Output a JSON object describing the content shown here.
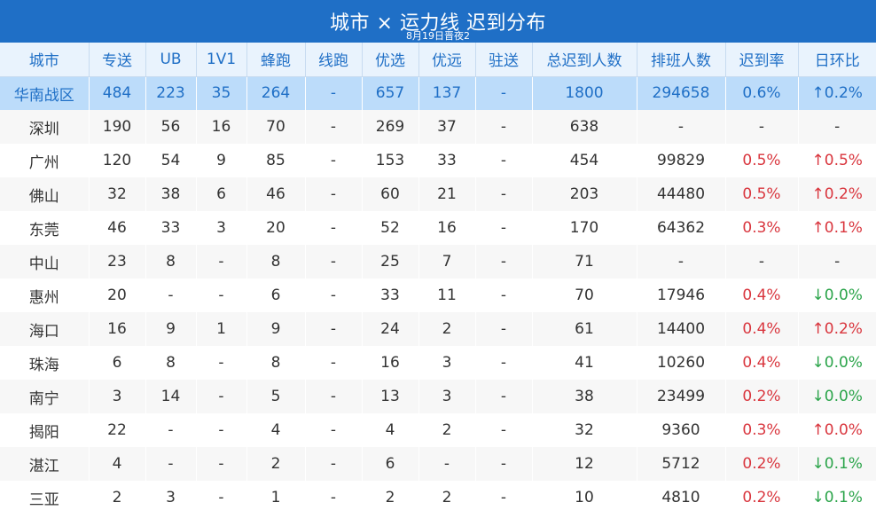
{
  "header": {
    "title": "城市 × 运力线 迟到分布",
    "subtitle": "8月19日晋夜2"
  },
  "columns": [
    "城市",
    "专送",
    "UB",
    "1V1",
    "蜂跑",
    "线跑",
    "优选",
    "优远",
    "驻送",
    "总迟到人数",
    "排班人数",
    "迟到率",
    "日环比"
  ],
  "summary": [
    "华南战区",
    "484",
    "223",
    "35",
    "264",
    "-",
    "657",
    "137",
    "-",
    "1800",
    "294658",
    "0.6%",
    "↑0.2%"
  ],
  "rows": [
    [
      "深圳",
      "190",
      "56",
      "16",
      "70",
      "-",
      "269",
      "37",
      "-",
      "638",
      "-",
      "-",
      "-"
    ],
    [
      "广州",
      "120",
      "54",
      "9",
      "85",
      "-",
      "153",
      "33",
      "-",
      "454",
      "99829",
      "0.5%",
      "↑0.5%"
    ],
    [
      "佛山",
      "32",
      "38",
      "6",
      "46",
      "-",
      "60",
      "21",
      "-",
      "203",
      "44480",
      "0.5%",
      "↑0.2%"
    ],
    [
      "东莞",
      "46",
      "33",
      "3",
      "20",
      "-",
      "52",
      "16",
      "-",
      "170",
      "64362",
      "0.3%",
      "↑0.1%"
    ],
    [
      "中山",
      "23",
      "8",
      "-",
      "8",
      "-",
      "25",
      "7",
      "-",
      "71",
      "-",
      "-",
      "-"
    ],
    [
      "惠州",
      "20",
      "-",
      "-",
      "6",
      "-",
      "33",
      "11",
      "-",
      "70",
      "17946",
      "0.4%",
      "↓0.0%"
    ],
    [
      "海口",
      "16",
      "9",
      "1",
      "9",
      "-",
      "24",
      "2",
      "-",
      "61",
      "14400",
      "0.4%",
      "↑0.2%"
    ],
    [
      "珠海",
      "6",
      "8",
      "-",
      "8",
      "-",
      "16",
      "3",
      "-",
      "41",
      "10260",
      "0.4%",
      "↓0.0%"
    ],
    [
      "南宁",
      "3",
      "14",
      "-",
      "5",
      "-",
      "13",
      "3",
      "-",
      "38",
      "23499",
      "0.2%",
      "↓0.0%"
    ],
    [
      "揭阳",
      "22",
      "-",
      "-",
      "4",
      "-",
      "4",
      "2",
      "-",
      "32",
      "9360",
      "0.3%",
      "↑0.0%"
    ],
    [
      "湛江",
      "4",
      "-",
      "-",
      "2",
      "-",
      "6",
      "-",
      "-",
      "12",
      "5712",
      "0.2%",
      "↓0.1%"
    ],
    [
      "三亚",
      "2",
      "3",
      "-",
      "1",
      "-",
      "2",
      "2",
      "-",
      "10",
      "4810",
      "0.2%",
      "↓0.1%"
    ]
  ],
  "colors": {
    "brand": "#1f6fc6",
    "header_bg": "#e9f3fd",
    "summary_bg": "#bcdcfa",
    "rate_red": "#d9363e",
    "trend_up": "#d9363e",
    "trend_down": "#2ba44a"
  }
}
